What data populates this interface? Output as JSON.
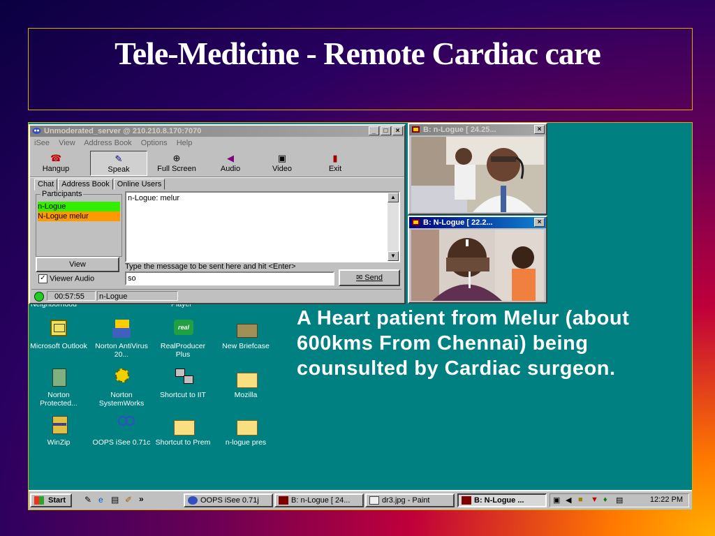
{
  "slide": {
    "title": "Tele-Medicine - Remote Cardiac care"
  },
  "isee": {
    "title": "Unmoderated_server @ 210.210.8.170:7070",
    "menu": [
      "iSee",
      "View",
      "Address Book",
      "Options",
      "Help"
    ],
    "tools": [
      "Hangup",
      "Speak",
      "Full Screen",
      "Audio",
      "Video",
      "Exit"
    ],
    "tabs": [
      "Chat",
      "Address Book",
      "Online Users"
    ],
    "participants_label": "Participants",
    "participants": [
      "n-Logue",
      "N-Logue melur"
    ],
    "chat_line": "n-Logue: melur",
    "view_button": "View",
    "viewer_audio": "Viewer Audio",
    "message_hint": "Type the message to be sent here and hit <Enter>",
    "message_value": "so",
    "send_button": "Send",
    "status_time": "00:57:55",
    "status_user": "n-Logue"
  },
  "video1": {
    "title": "B: n-Logue [ 24.25..."
  },
  "video2": {
    "title": "B: N-Logue [ 22.2..."
  },
  "desktop": {
    "cut_labels": [
      "Neighborhood",
      "Player"
    ],
    "icons": [
      {
        "label": "Microsoft Outlook",
        "icon": "outlook-icon"
      },
      {
        "label": "Norton AntiVirus 20...",
        "icon": "norton-antivirus-icon"
      },
      {
        "label": "RealProducer Plus",
        "icon": "realproducer-icon"
      },
      {
        "label": "New Briefcase",
        "icon": "briefcase-icon"
      },
      {
        "label": "Norton Protected...",
        "icon": "recycle-bin-icon"
      },
      {
        "label": "Norton SystemWorks",
        "icon": "norton-systemworks-icon"
      },
      {
        "label": "Shortcut to IIT",
        "icon": "network-shortcut-icon"
      },
      {
        "label": "Mozilla",
        "icon": "folder-icon"
      },
      {
        "label": "WinZip",
        "icon": "winzip-icon"
      },
      {
        "label": "OOPS iSee 0.71c",
        "icon": "isee-icon"
      },
      {
        "label": "Shortcut to Prem",
        "icon": "folder-shortcut-icon"
      },
      {
        "label": "n-logue pres",
        "icon": "folder-icon"
      }
    ],
    "caption": "A Heart patient from Melur (about 600kms From Chennai) being counsulted by Cardiac surgeon."
  },
  "taskbar": {
    "start": "Start",
    "quick_more": "»",
    "buttons": [
      "OOPS iSee 0.71j",
      "B: n-Logue [ 24...",
      "dr3.jpg - Paint",
      "B: N-Logue ..."
    ],
    "clock": "12:22 PM"
  },
  "colors": {
    "desktop": "#008080",
    "titlebar": "#000080",
    "participant_green": "#33ee00",
    "participant_orange": "#ff9900"
  }
}
